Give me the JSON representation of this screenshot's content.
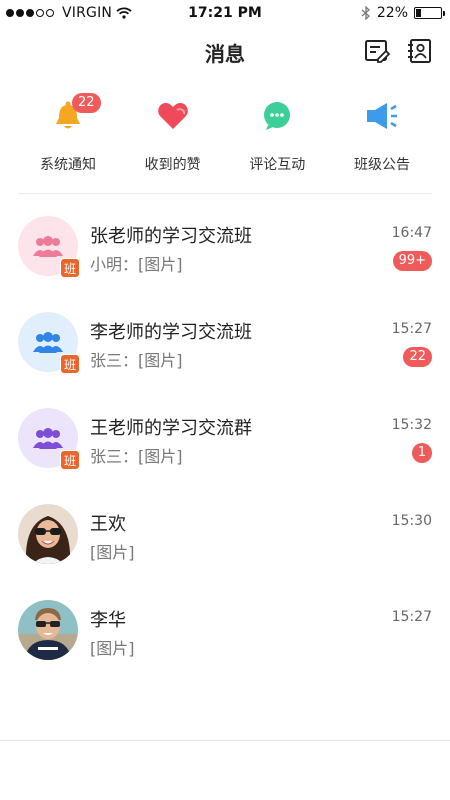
{
  "status_bar": {
    "carrier": "VIRGIN",
    "time": "17:21 PM",
    "battery": "22%",
    "battery_level": 0.22,
    "signal_filled": 3,
    "signal_total": 5
  },
  "header": {
    "title": "消息",
    "compose_icon": "compose-list-icon",
    "contacts_icon": "contacts-book-icon"
  },
  "categories": [
    {
      "label": "系统通知",
      "icon": "bell-icon",
      "color": "#f5a623",
      "badge": "22"
    },
    {
      "label": "收到的赞",
      "icon": "heart-icon",
      "color": "#ef4a5a",
      "badge": ""
    },
    {
      "label": "评论互动",
      "icon": "comment-icon",
      "color": "#3ccf9a",
      "badge": ""
    },
    {
      "label": "班级公告",
      "icon": "megaphone-icon",
      "color": "#3d9be9",
      "badge": ""
    }
  ],
  "chats": [
    {
      "name": "张老师的学习交流班",
      "preview": "小明：[图片]",
      "time": "16:47",
      "badge": "99+",
      "type": "group",
      "avatar_color": "#fde4ea",
      "icon_color": "#ef7b9a",
      "tag": "班"
    },
    {
      "name": "李老师的学习交流班",
      "preview": "张三：[图片]",
      "time": "15:27",
      "badge": "22",
      "type": "group",
      "avatar_color": "#e1eefb",
      "icon_color": "#2f86e6",
      "tag": "班"
    },
    {
      "name": "王老师的学习交流群",
      "preview": "张三：[图片]",
      "time": "15:32",
      "badge": "1",
      "type": "group",
      "avatar_color": "#ece4fb",
      "icon_color": "#7e4fd6",
      "tag": "班"
    },
    {
      "name": "王欢",
      "preview": "[图片]",
      "time": "15:30",
      "badge": "",
      "type": "person",
      "avatar": "woman-photo"
    },
    {
      "name": "李华",
      "preview": "[图片]",
      "time": "15:27",
      "badge": "",
      "type": "person",
      "avatar": "man-photo"
    }
  ]
}
